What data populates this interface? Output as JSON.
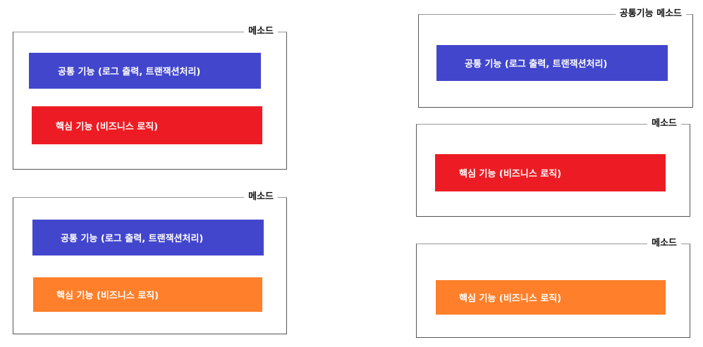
{
  "colors": {
    "common": "#4246cc",
    "core": "#ed1c24",
    "core_alt": "#ff7f2a"
  },
  "left": {
    "top": {
      "label": "메소드",
      "common": "공통 기능  (로그 출력, 트랜잭션처리)",
      "core": "핵심 기능 (비즈니스 로직)"
    },
    "bottom": {
      "label": "메소드",
      "common": "공통 기능  (로그 출력, 트랜잭션처리)",
      "core": "핵심 기능 (비즈니스 로직)"
    }
  },
  "right": {
    "common_method": {
      "label": "공통기능 메소드",
      "common": "공통 기능  (로그 출력, 트랜잭션처리)"
    },
    "method1": {
      "label": "메소드",
      "core": "핵심 기능 (비즈니스 로직)"
    },
    "method2": {
      "label": "메소드",
      "core": "핵심 기능 (비즈니스 로직)"
    }
  }
}
